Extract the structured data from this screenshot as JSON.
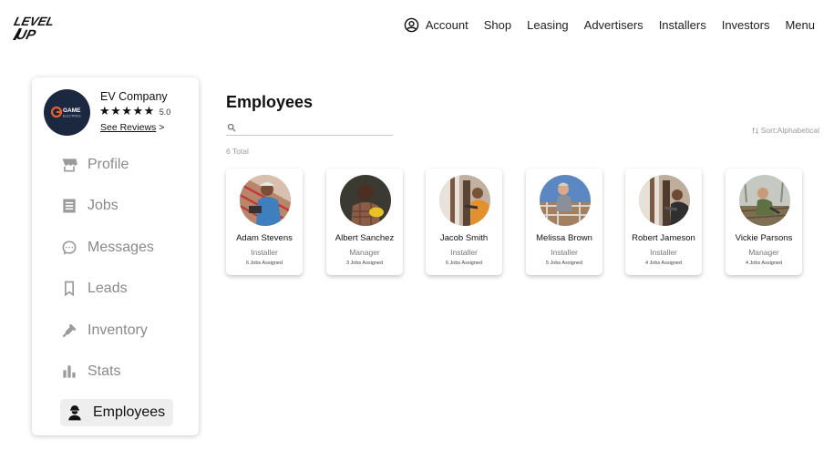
{
  "header": {
    "logo": {
      "line1": "LEVEL",
      "line2": "UP"
    },
    "nav": [
      {
        "label": "Account",
        "icon": "account-circle-icon"
      },
      {
        "label": "Shop"
      },
      {
        "label": "Leasing"
      },
      {
        "label": "Advertisers"
      },
      {
        "label": "Installers"
      },
      {
        "label": "Investors"
      },
      {
        "label": "Menu"
      }
    ]
  },
  "company": {
    "name": "EV Company",
    "stars": "★★★★★",
    "rating": "5.0",
    "reviews_link": "See Reviews",
    "reviews_arrow": ">",
    "logo_text": "GAME",
    "logo_subtext": "ELECTRICS"
  },
  "sidebar": {
    "items": [
      {
        "label": "Profile",
        "icon": "storefront-icon"
      },
      {
        "label": "Jobs",
        "icon": "list-icon"
      },
      {
        "label": "Messages",
        "icon": "chat-bubble-icon"
      },
      {
        "label": "Leads",
        "icon": "bookmark-icon"
      },
      {
        "label": "Inventory",
        "icon": "tool-icon"
      },
      {
        "label": "Stats",
        "icon": "bar-chart-icon"
      },
      {
        "label": "Employees",
        "icon": "worker-icon",
        "active": true
      }
    ]
  },
  "main": {
    "title": "Employees",
    "search": {
      "value": "",
      "placeholder": ""
    },
    "total": "6 Total",
    "sort": "Sort:Alphabetical"
  },
  "employees": [
    {
      "name": "Adam Stevens",
      "role": "Installer",
      "jobs": "6 Jobs Assigned"
    },
    {
      "name": "Albert Sanchez",
      "role": "Manager",
      "jobs": "3 Jobs Assigned"
    },
    {
      "name": "Jacob Smith",
      "role": "Installer",
      "jobs": "6 Jobs Assigned"
    },
    {
      "name": "Melissa Brown",
      "role": "Installer",
      "jobs": "5 Jobs Assigned"
    },
    {
      "name": "Robert Jameson",
      "role": "Installer",
      "jobs": "4 Jobs Assigned"
    },
    {
      "name": "Vickie Parsons",
      "role": "Manager",
      "jobs": "4 Jobs Assigned"
    }
  ],
  "colors": {
    "active_bg": "#eeeeee",
    "inactive_text": "#8a8a8a",
    "company_logo_bg": "#1c2740",
    "logo_accent": "#e8612c"
  }
}
